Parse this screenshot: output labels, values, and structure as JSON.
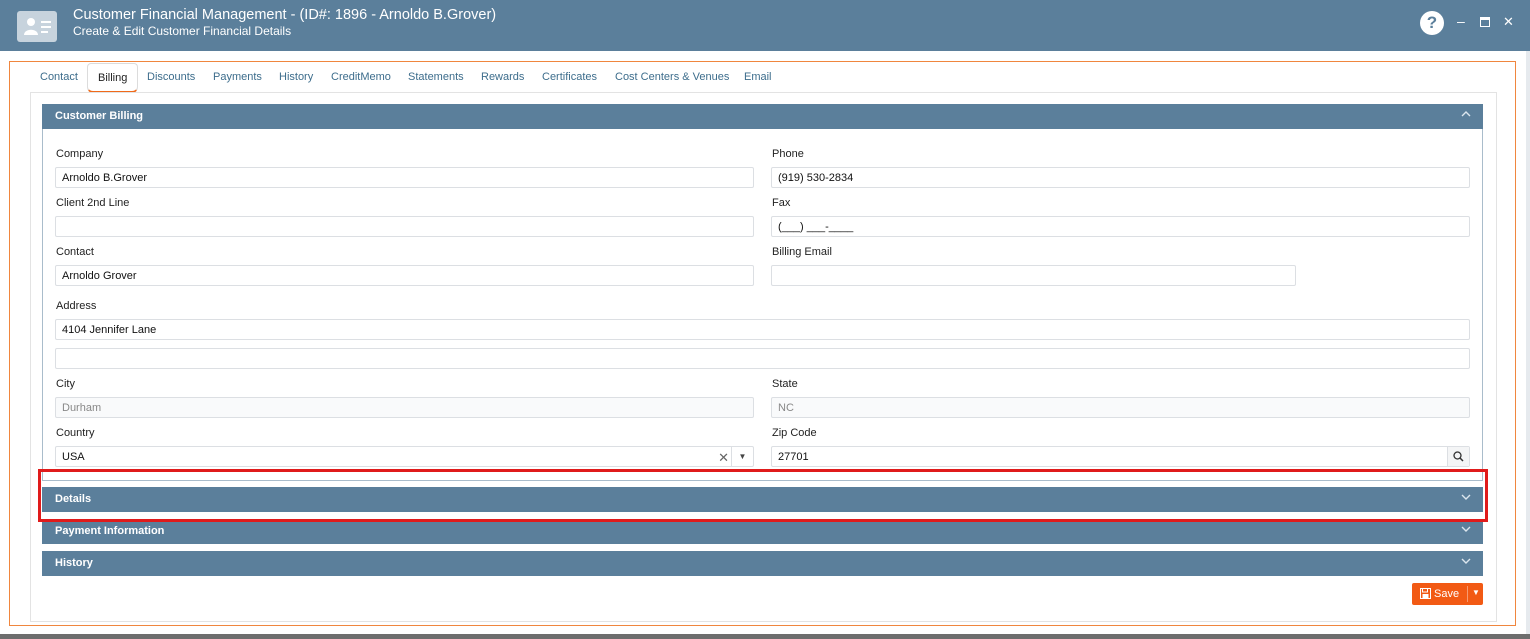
{
  "window": {
    "title": "Customer Financial Management - (ID#: 1896 - Arnoldo B.Grover)",
    "subtitle": "Create & Edit Customer Financial Details",
    "help_label": "?",
    "minimize_label": "–",
    "close_label": "✕"
  },
  "tabs": [
    {
      "label": "Contact"
    },
    {
      "label": "Billing",
      "active": true
    },
    {
      "label": "Discounts"
    },
    {
      "label": "Payments"
    },
    {
      "label": "History"
    },
    {
      "label": "CreditMemo"
    },
    {
      "label": "Statements"
    },
    {
      "label": "Rewards"
    },
    {
      "label": "Certificates"
    },
    {
      "label": "Cost Centers & Venues"
    },
    {
      "label": "Email"
    }
  ],
  "sections": {
    "billing": {
      "label": "Customer Billing",
      "expanded": true
    },
    "details": {
      "label": "Details",
      "expanded": false
    },
    "payment": {
      "label": "Payment Information",
      "expanded": false
    },
    "history": {
      "label": "History",
      "expanded": false
    }
  },
  "fields": {
    "company": {
      "label": "Company",
      "value": "Arnoldo B.Grover"
    },
    "phone": {
      "label": "Phone",
      "value": "(919) 530-2834"
    },
    "client2": {
      "label": "Client 2nd Line",
      "value": ""
    },
    "fax": {
      "label": "Fax",
      "value": "(___) ___-____"
    },
    "contact": {
      "label": "Contact",
      "value": "Arnoldo Grover"
    },
    "billing_email": {
      "label": "Billing Email",
      "value": ""
    },
    "address": {
      "label": "Address",
      "value": "4104 Jennifer Lane",
      "value2": ""
    },
    "city": {
      "label": "City",
      "value": "Durham"
    },
    "state": {
      "label": "State",
      "value": "NC"
    },
    "country": {
      "label": "Country",
      "value": "USA",
      "clear": "✕",
      "caret": "▼"
    },
    "zip": {
      "label": "Zip Code",
      "value": "27701"
    }
  },
  "actions": {
    "save_label": "Save",
    "save_caret": "▼"
  },
  "colors": {
    "header": "#5b7f9b",
    "accent": "#f25a14",
    "highlight": "#e01b1b"
  },
  "icons": [
    "contact-card-icon",
    "help-icon",
    "minimize-icon",
    "maximize-icon",
    "close-icon",
    "chevron-up-icon",
    "chevron-down-icon",
    "search-icon",
    "floppy-icon"
  ]
}
